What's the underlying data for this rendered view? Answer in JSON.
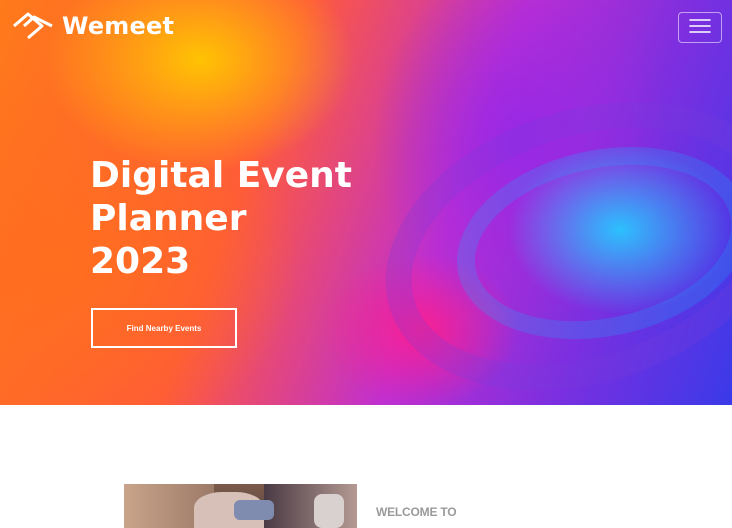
{
  "header": {
    "brand": "Wemeet",
    "logo_icon": "wemeet-logo-icon",
    "menu_icon": "hamburger-menu-icon"
  },
  "hero": {
    "title_lines": [
      "Digital Event",
      "Planner",
      "2023"
    ],
    "cta_label": "Find Nearby Events"
  },
  "about": {
    "eyebrow": "WELCOME TO",
    "image": "event-photo"
  },
  "colors": {
    "text_light": "#ffffff",
    "muted": "#9a9a9a",
    "accent_orange": "#ff7a1a",
    "accent_purple": "#9b30e0",
    "accent_blue": "#28c8ff"
  }
}
